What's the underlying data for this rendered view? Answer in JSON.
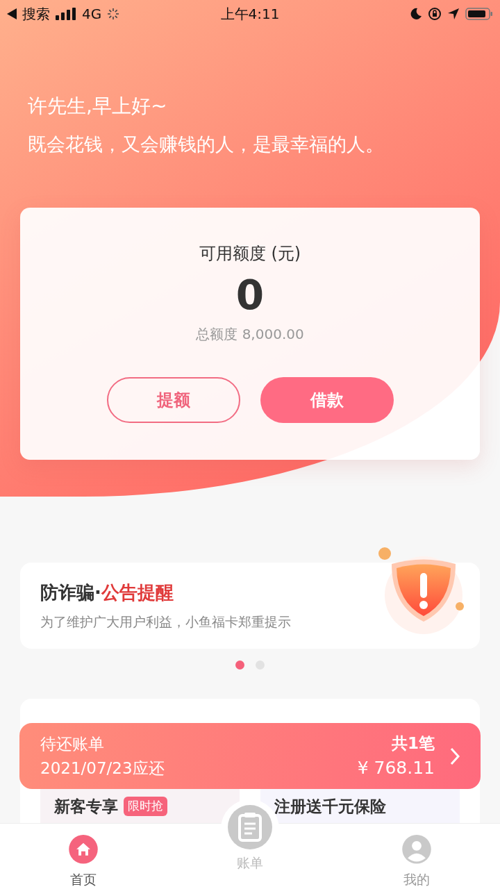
{
  "status_bar": {
    "back_label": "搜索",
    "network": "4G",
    "time": "上午4:11"
  },
  "header": {
    "greeting": "许先生,早上好~",
    "motto": "既会花钱，又会赚钱的人，是最幸福的人。"
  },
  "credit": {
    "label": "可用额度 (元)",
    "amount": "0",
    "total": "总额度 8,000.00",
    "buttons": [
      {
        "label": "提额",
        "kind": "outline"
      },
      {
        "label": "借款",
        "kind": "filled"
      }
    ]
  },
  "notice": {
    "title": "防诈骗·",
    "title_highlight": "公告提醒",
    "subtitle": "为了维护广大用户利益，小鱼福卡郑重提示",
    "dots": [
      {
        "selected": true
      },
      {
        "selected": false
      }
    ]
  },
  "bill": {
    "title": "待还账单",
    "due": "2021/07/23应还",
    "count": "共1笔",
    "amount": "¥ 768.11"
  },
  "promos": [
    {
      "title": "新客专享",
      "badge": "限时抢"
    },
    {
      "title": "注册送千元保险"
    }
  ],
  "tab_bar": [
    {
      "label": "首页",
      "kind": "home",
      "selected": true
    },
    {
      "label": "账单",
      "kind": "bill",
      "selected": false
    },
    {
      "label": "我的",
      "kind": "profile",
      "selected": false
    }
  ]
}
